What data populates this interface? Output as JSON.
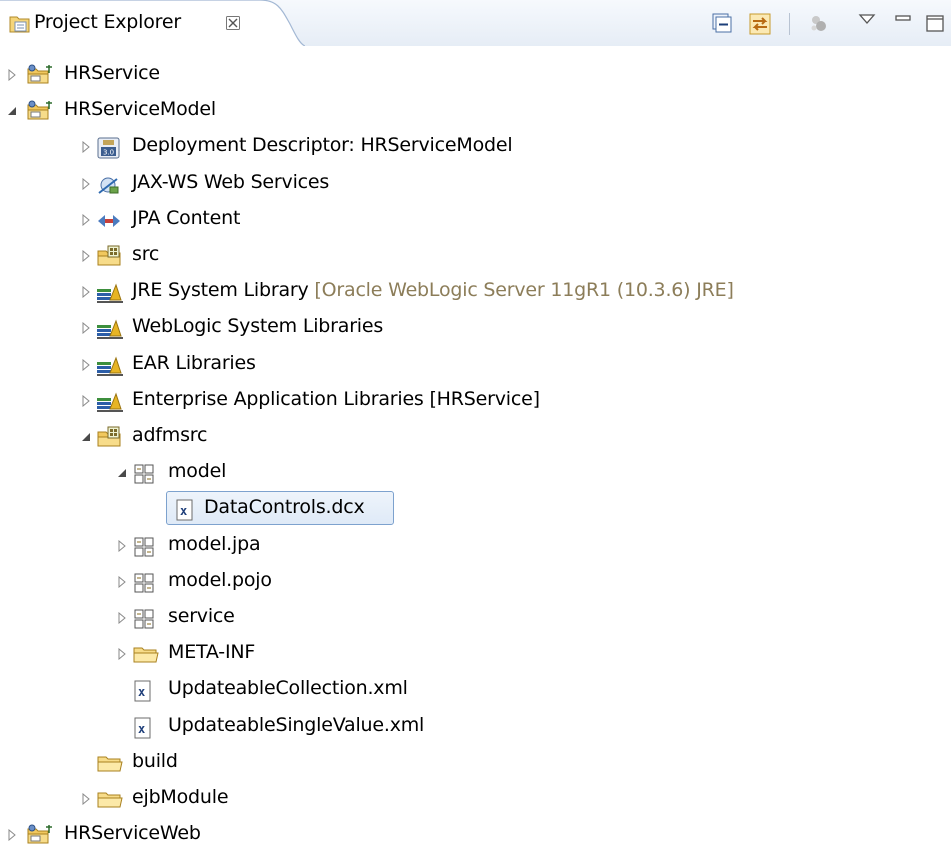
{
  "view": {
    "title": "Project Explorer",
    "close_symbol": "☒",
    "toolbar": [
      {
        "name": "collapse-all-icon"
      },
      {
        "name": "link-with-editor-icon"
      },
      {
        "name": "filter-icon"
      },
      {
        "name": "view-menu-icon"
      },
      {
        "name": "minimize-icon"
      },
      {
        "name": "maximize-icon"
      }
    ]
  },
  "tree": [
    {
      "label": "HRService",
      "icon": "project-icon",
      "expander": "collapsed",
      "level": 0
    },
    {
      "label": "HRServiceModel",
      "icon": "project-icon",
      "expander": "expanded",
      "level": 0
    },
    {
      "label": "Deployment Descriptor: HRServiceModel",
      "icon": "deployment-descriptor-icon",
      "expander": "collapsed",
      "level": 1
    },
    {
      "label": "JAX-WS Web Services",
      "icon": "web-services-icon",
      "expander": "collapsed",
      "level": 1
    },
    {
      "label": "JPA Content",
      "icon": "jpa-icon",
      "expander": "collapsed",
      "level": 1
    },
    {
      "label": "src",
      "icon": "source-folder-icon",
      "expander": "collapsed",
      "level": 1
    },
    {
      "label": "JRE System Library",
      "decoration": "[Oracle WebLogic Server 11gR1 (10.3.6) JRE]",
      "icon": "library-icon",
      "expander": "collapsed",
      "level": 1
    },
    {
      "label": "WebLogic System Libraries",
      "icon": "library-icon",
      "expander": "collapsed",
      "level": 1
    },
    {
      "label": "EAR Libraries",
      "icon": "library-icon",
      "expander": "collapsed",
      "level": 1
    },
    {
      "label": "Enterprise Application Libraries [HRService]",
      "icon": "library-icon",
      "expander": "collapsed",
      "level": 1
    },
    {
      "label": "adfmsrc",
      "icon": "source-folder-icon",
      "expander": "expanded",
      "level": 1
    },
    {
      "label": "model",
      "icon": "package-icon",
      "expander": "expanded",
      "level": 2
    },
    {
      "label": "DataControls.dcx",
      "icon": "xml-file-icon",
      "expander": "none",
      "level": 3,
      "selected": true
    },
    {
      "label": "model.jpa",
      "icon": "package-icon",
      "expander": "collapsed",
      "level": 2
    },
    {
      "label": "model.pojo",
      "icon": "package-icon",
      "expander": "collapsed",
      "level": 2
    },
    {
      "label": "service",
      "icon": "package-icon",
      "expander": "collapsed",
      "level": 2
    },
    {
      "label": "META-INF",
      "icon": "folder-icon",
      "expander": "collapsed",
      "level": 2
    },
    {
      "label": "UpdateableCollection.xml",
      "icon": "xml-file-icon",
      "expander": "none",
      "level": 2
    },
    {
      "label": "UpdateableSingleValue.xml",
      "icon": "xml-file-icon",
      "expander": "none",
      "level": 2
    },
    {
      "label": "build",
      "icon": "folder-icon",
      "expander": "none",
      "level": 1
    },
    {
      "label": "ejbModule",
      "icon": "folder-icon",
      "expander": "collapsed",
      "level": 1
    },
    {
      "label": "HRServiceWeb",
      "icon": "project-icon",
      "expander": "collapsed",
      "level": 0
    }
  ]
}
